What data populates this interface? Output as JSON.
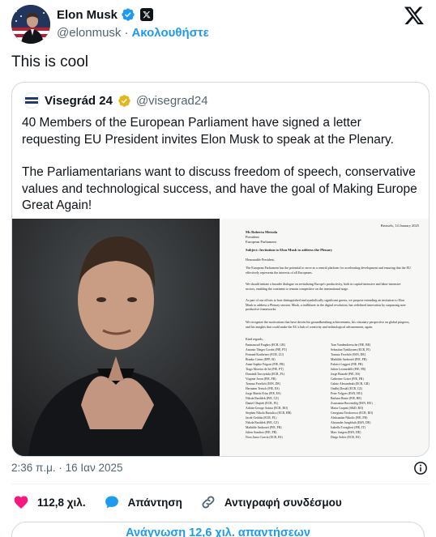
{
  "author": {
    "name": "Elon Musk",
    "handle": "@elonmusk",
    "separator": "·",
    "follow_label": "Ακολουθήστε",
    "verified_color": "#1d9bf0"
  },
  "tweet": {
    "text": "This is cool",
    "timestamp": "2:36 π.μ. · 16 Ιαν 2025"
  },
  "quoted": {
    "name": "Visegrád 24",
    "handle": "@visegrad24",
    "verified_color": "#e2b719",
    "paragraph_1": "40 Members of the European Parliament have signed a letter requesting EU President  invites Elon Musk to speak at the Plenary.",
    "paragraph_2": "The Parliamentarians want to discuss freedom of speech, conservative values and technological success, and have the goal of Making Europe Great Again!"
  },
  "letter": {
    "date": "Brussels, 14 January 2025",
    "to_1": "Ms Roberta Metsola",
    "to_2": "President",
    "to_3": "European Parliament",
    "subject": "Subject: Invitation to Elon Musk to address the Plenary",
    "salutation": "Honourable President,",
    "body_1": "The European Parliament has the potential to serve as a central platform for accelerating development and ensuring that the EU effectively represents the interests of all Europeans.",
    "body_2": "We should initiate a broader dialogue on revitalizing Europe's productivity, both in capital-intensive and labor-intensive sectors, enabling the continent to remain competitive on the international stage.",
    "body_3": "As part of our efforts to host distinguished and symbolically significant guests, we propose extending an invitation to Elon Musk to address a Plenary session. Musk, a trailblazer in the digital revolution, has redefined innovation by surpassing non-productive frameworks.",
    "body_4": "We recognize the motivations that have driven his groundbreaking achievements, his visionary perspective on global progress, and his insights that could make the EU a hub of creativity and technological advancement, again.",
    "closing": "Kind regards,",
    "signatories_left": [
      "Emmanouil Fragkos (ECR, GR)",
      "Antonio Tânger Corrêa (PfE, PT)",
      "Fernand Kartheiser (ECR, LU)",
      "Branko Grims (EPP, SI)",
      "Anne-Sophie Frigout (PfE, FR)",
      "Tiago Moreira de Sá (PfE, PT)",
      "Dominik Tarczyński (ECR, PL)",
      "Virginie Joron (PfE, FR)",
      "Tomasz Froelich (ESN, DE)",
      "Hermann Tertsch (PfE, ES)",
      "Jorge Martín Frías (PfE, ES)",
      "Nikola Bartůšek (PfE, CZ)",
      "Daniel Obajtek (ECR, PL)",
      "Adrian-George Axinia (ECR, RO)",
      "Stephen Nikola Bartulica (ECR, HR)",
      "Jacek Ozdoba (ECR, PL)",
      "Nikola Bartůšek (PfE, CZ)",
      "Mathilde Androuët (PfE, FR)",
      "Julien Sanchez (PfE, FR)",
      "Nora Junco García (ECR, ES)"
    ],
    "signatories_right": [
      "Tom Vandendriessche (PfE, BE)",
      "Sebastian Tynkkynen (ECR, FI)",
      "Tomasz Froelich (ESN, DE)",
      "Mathilde Androuët (PfE, FR)",
      "Fabrice Leggeri (PfE, FR)",
      "Julien Leonardelli (PfE, FR)",
      "Jorge Buxadé (PfE, ES)",
      "Catherine Griset (PfE, FR)",
      "Galato Alexandraki (ECR, GR)",
      "Ondřej Dostál (ECR, CZ)",
      "Peter Volgyes (ESN, HU)",
      "Barbara Bonte (PfE, BE)",
      "Zsuzsanna Borvendég (ESN, HU)",
      "Maria Grapini (S&D, RO)",
      "Georgiana Teodorescu (ECR, RO)",
      "Aleksandar Nikolic (PfE, FR)",
      "Alexander Jungbluth (ESN, DE)",
      "Isabella Tovaglieri (PfE, IT)",
      "Marc Jongen (ESN, DE)",
      "Diego Solier (ECR, ES)"
    ]
  },
  "actions": {
    "likes": "112,8 χιλ.",
    "reply_label": "Απάντηση",
    "copy_link_label": "Αντιγραφή συνδέσμου",
    "like_color": "#f91880"
  },
  "replies_button": "Ανάγνωση 12,6 χιλ. απαντήσεων"
}
